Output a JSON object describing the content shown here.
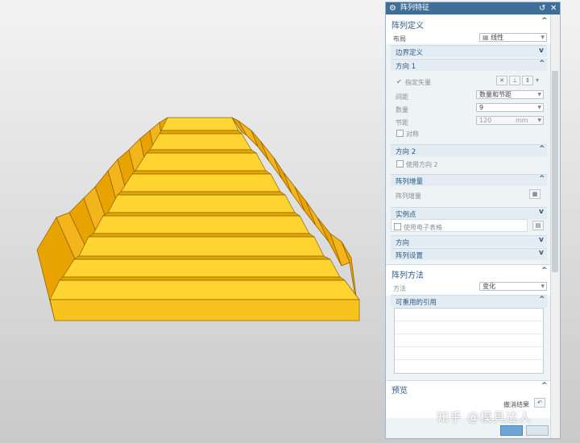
{
  "dialog": {
    "title": "阵列特征",
    "icons": {
      "settings": "gear-icon",
      "reset": "reset-icon",
      "close": "close-icon"
    },
    "sections": {
      "pattern_definition": {
        "title": "阵列定义",
        "layout_label": "布局",
        "layout_value": "线性",
        "boundary_definition": "边界定义",
        "direction1": {
          "title": "方向 1",
          "specify_vector": "指定矢量",
          "spacing_label": "间距",
          "spacing_value": "数量和节距",
          "count_label": "数量",
          "count_value": "9",
          "pitch_label": "节距",
          "pitch_value": "120",
          "pitch_unit": "mm",
          "symmetric_label": "对称"
        },
        "direction2": {
          "title": "方向 2",
          "use_direction2": "使用方向 2"
        },
        "pattern_increment": {
          "title": "阵列增量",
          "label": "阵列增量"
        },
        "instance_points": {
          "title": "实例点",
          "use_spreadsheet": "使用电子表格"
        },
        "orientation": "方向",
        "pattern_settings": "阵列设置"
      },
      "pattern_method": {
        "title": "阵列方法",
        "method_label": "方法",
        "method_value": "变化",
        "reusable_refs": "可重用的引用"
      },
      "preview": {
        "title": "预览",
        "undo_result": "撤消结果"
      }
    }
  },
  "watermark": "知乎 @模具达人",
  "colors": {
    "title_bar": "#3f6f98",
    "section_text": "#2a5b86",
    "pyramid_top": "#FFD430",
    "pyramid_side": "#E8A400",
    "pyramid_front": "#F7C31C"
  }
}
